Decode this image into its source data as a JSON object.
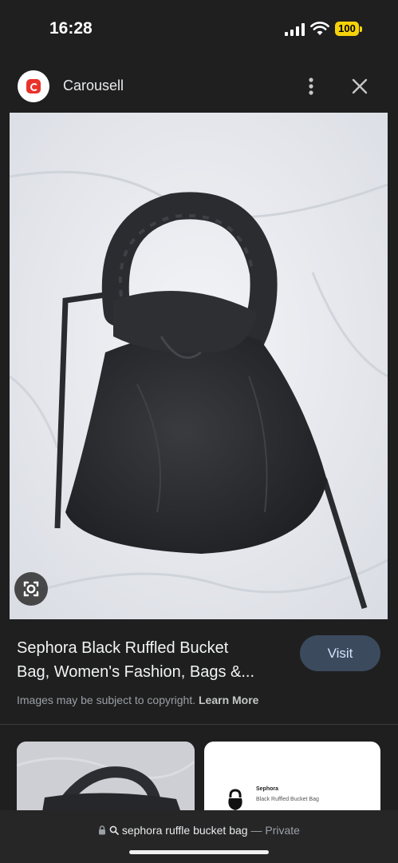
{
  "status_bar": {
    "time": "16:28",
    "battery": "100",
    "battery_color": "#f5d20a"
  },
  "site": {
    "name": "Carousell",
    "brand_color": "#e9322b"
  },
  "result": {
    "title_line1": "Sephora Black Ruffled Bucket",
    "title_line2": "Bag, Women's Fashion, Bags &...",
    "visit_label": "Visit",
    "copyright_text": "Images may be subject to copyright.",
    "learn_more": "Learn More"
  },
  "related": [
    {
      "brand": "",
      "name": ""
    },
    {
      "brand": "Sephora",
      "name": "Black Ruffled Bucket Bag"
    }
  ],
  "url_bar": {
    "query": "sephora ruffle bucket bag",
    "separator": "—",
    "mode": "Private"
  },
  "icons": [
    "signal-icon",
    "wifi-icon",
    "battery-icon",
    "more-vert-icon",
    "close-icon",
    "lens-icon",
    "lock-icon",
    "search-icon"
  ]
}
